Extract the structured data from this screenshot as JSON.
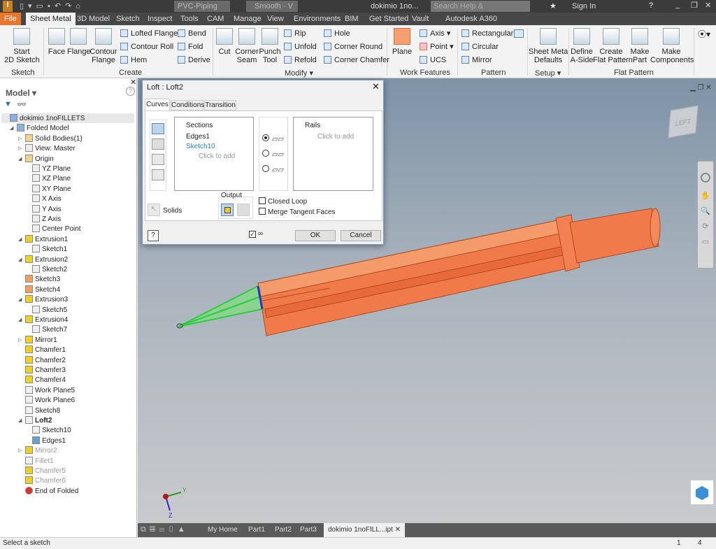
{
  "titlebar": {
    "material": "PVC-Piping",
    "appearance": "Smooth - V",
    "doc_title": "dokimio 1no...",
    "search_placeholder": "Search Help & Commands...",
    "sign_in": "Sign In"
  },
  "ribbon_tabs": [
    "File",
    "Sheet Metal",
    "3D Model",
    "Sketch",
    "Inspect",
    "Tools",
    "CAM",
    "Manage",
    "View",
    "Environments",
    "BIM",
    "Get Started",
    "Vault",
    "Autodesk A360"
  ],
  "ribbon": {
    "sketch": {
      "start": "Start\n2D Sketch",
      "label": "Sketch"
    },
    "create": {
      "face": "Face",
      "flange": "Flange",
      "contour_flange": "Contour\nFlange",
      "lofted_flange": "Lofted Flange",
      "contour_roll": "Contour Roll",
      "hem": "Hem",
      "bend": "Bend",
      "fold": "Fold",
      "derive": "Derive",
      "label": "Create"
    },
    "modify": {
      "cut": "Cut",
      "corner_seam": "Corner\nSeam",
      "punch_tool": "Punch\nTool",
      "rip": "Rip",
      "unfold": "Unfold",
      "refold": "Refold",
      "hole": "Hole",
      "corner_round": "Corner Round",
      "corner_chamfer": "Corner Chamfer",
      "label": "Modify ▾"
    },
    "work_features": {
      "plane": "Plane",
      "axis": "Axis ▾",
      "point": "Point ▾",
      "ucs": "UCS",
      "label": "Work Features"
    },
    "pattern": {
      "rectangular": "Rectangular",
      "circular": "Circular",
      "mirror": "Mirror",
      "label": "Pattern"
    },
    "setup": {
      "defaults": "Sheet Metal\nDefaults",
      "label": "Setup ▾"
    },
    "flat_pattern": {
      "define_a_side": "Define\nA-Side",
      "create_flat": "Create\nFlat Pattern",
      "make_part": "Make\nPart",
      "make_components": "Make\nComponents",
      "label": "Flat Pattern"
    }
  },
  "browser": {
    "title": "Model ▾",
    "items": [
      {
        "label": "dokimio 1noFILLETS",
        "level": 0,
        "toggle": "",
        "icon": "part",
        "state": "normal"
      },
      {
        "label": "Folded Model",
        "level": 1,
        "toggle": "◢",
        "icon": "folded",
        "state": "normal"
      },
      {
        "label": "Solid Bodies(1)",
        "level": 2,
        "toggle": "▷",
        "icon": "folder",
        "state": "normal"
      },
      {
        "label": "View: Master",
        "level": 2,
        "toggle": "▷",
        "icon": "view",
        "state": "normal"
      },
      {
        "label": "Origin",
        "level": 2,
        "toggle": "◢",
        "icon": "folder",
        "state": "normal"
      },
      {
        "label": "YZ Plane",
        "level": 3,
        "toggle": "",
        "icon": "plane",
        "state": "normal"
      },
      {
        "label": "XZ Plane",
        "level": 3,
        "toggle": "",
        "icon": "plane",
        "state": "normal"
      },
      {
        "label": "XY Plane",
        "level": 3,
        "toggle": "",
        "icon": "plane",
        "state": "normal"
      },
      {
        "label": "X Axis",
        "level": 3,
        "toggle": "",
        "icon": "axis",
        "state": "normal"
      },
      {
        "label": "Y Axis",
        "level": 3,
        "toggle": "",
        "icon": "axis",
        "state": "normal"
      },
      {
        "label": "Z Axis",
        "level": 3,
        "toggle": "",
        "icon": "axis",
        "state": "normal"
      },
      {
        "label": "Center Point",
        "level": 3,
        "toggle": "",
        "icon": "point",
        "state": "normal"
      },
      {
        "label": "Extrusion1",
        "level": 2,
        "toggle": "◢",
        "icon": "extrusion",
        "state": "normal"
      },
      {
        "label": "Sketch1",
        "level": 3,
        "toggle": "",
        "icon": "sketch",
        "state": "normal"
      },
      {
        "label": "Extrusion2",
        "level": 2,
        "toggle": "◢",
        "icon": "extrusion",
        "state": "normal"
      },
      {
        "label": "Sketch2",
        "level": 3,
        "toggle": "",
        "icon": "sketch",
        "state": "normal"
      },
      {
        "label": "Sketch3",
        "level": 2,
        "toggle": "",
        "icon": "sketch-active",
        "state": "normal"
      },
      {
        "label": "Sketch4",
        "level": 2,
        "toggle": "",
        "icon": "sketch-active",
        "state": "normal"
      },
      {
        "label": "Extrusion3",
        "level": 2,
        "toggle": "◢",
        "icon": "extrusion",
        "state": "normal"
      },
      {
        "label": "Sketch5",
        "level": 3,
        "toggle": "",
        "icon": "sketch",
        "state": "normal"
      },
      {
        "label": "Extrusion4",
        "level": 2,
        "toggle": "◢",
        "icon": "extrusion",
        "state": "normal"
      },
      {
        "label": "Sketch7",
        "level": 3,
        "toggle": "",
        "icon": "sketch",
        "state": "normal"
      },
      {
        "label": "Mirror1",
        "level": 2,
        "toggle": "▷",
        "icon": "mirror",
        "state": "normal"
      },
      {
        "label": "Chamfer1",
        "level": 2,
        "toggle": "",
        "icon": "chamfer",
        "state": "normal"
      },
      {
        "label": "Chamfer2",
        "level": 2,
        "toggle": "",
        "icon": "chamfer",
        "state": "normal"
      },
      {
        "label": "Chamfer3",
        "level": 2,
        "toggle": "",
        "icon": "chamfer",
        "state": "normal"
      },
      {
        "label": "Chamfer4",
        "level": 2,
        "toggle": "",
        "icon": "chamfer",
        "state": "normal"
      },
      {
        "label": "Work Plane5",
        "level": 2,
        "toggle": "",
        "icon": "plane",
        "state": "normal"
      },
      {
        "label": "Work Plane6",
        "level": 2,
        "toggle": "",
        "icon": "plane",
        "state": "normal"
      },
      {
        "label": "Sketch8",
        "level": 2,
        "toggle": "",
        "icon": "sketch",
        "state": "normal"
      },
      {
        "label": "Loft2",
        "level": 2,
        "toggle": "◢",
        "icon": "loft",
        "state": "bold"
      },
      {
        "label": "Sketch10",
        "level": 3,
        "toggle": "",
        "icon": "sketch",
        "state": "normal"
      },
      {
        "label": "Edges1",
        "level": 3,
        "toggle": "",
        "icon": "edges",
        "state": "normal"
      },
      {
        "label": "Mirror2",
        "level": 2,
        "toggle": "▷",
        "icon": "mirror",
        "state": "suppressed"
      },
      {
        "label": "Fillet1",
        "level": 2,
        "toggle": "",
        "icon": "fillet",
        "state": "suppressed"
      },
      {
        "label": "Chamfer5",
        "level": 2,
        "toggle": "",
        "icon": "chamfer",
        "state": "suppressed"
      },
      {
        "label": "Chamfer6",
        "level": 2,
        "toggle": "",
        "icon": "chamfer",
        "state": "suppressed"
      },
      {
        "label": "End of Folded",
        "level": 2,
        "toggle": "",
        "icon": "end",
        "state": "normal"
      }
    ]
  },
  "dialog": {
    "title": "Loft : Loft2",
    "tabs": [
      "Curves",
      "Conditions",
      "Transition"
    ],
    "sections_header": "Sections",
    "sections": [
      "Edges1",
      "Sketch10"
    ],
    "click_to_add": "Click to add",
    "rails_header": "Rails",
    "rails_click": "Click to add",
    "output_label": "Output",
    "solids_label": "Solids",
    "closed_loop": "Closed Loop",
    "merge_tangent": "Merge Tangent Faces",
    "ok": "OK",
    "cancel": "Cancel",
    "closed_loop_checked": false,
    "merge_tangent_checked": false,
    "preview_checked": true,
    "selected_mode": "rails"
  },
  "viewcube": {
    "face": "LEFT"
  },
  "triad": {
    "y": "Y",
    "z": "Z"
  },
  "doc_tabs": [
    "My Home",
    "Part1",
    "Part2",
    "Part3",
    "dokimio 1noFILL...ipt"
  ],
  "status": {
    "message": "Select a sketch",
    "count1": "1",
    "count2": "4"
  },
  "colors": {
    "model": "#f07a4a",
    "file_tab": "#e8762c",
    "preview": "#2ecc40",
    "sketch_link": "#2a7fd4"
  }
}
